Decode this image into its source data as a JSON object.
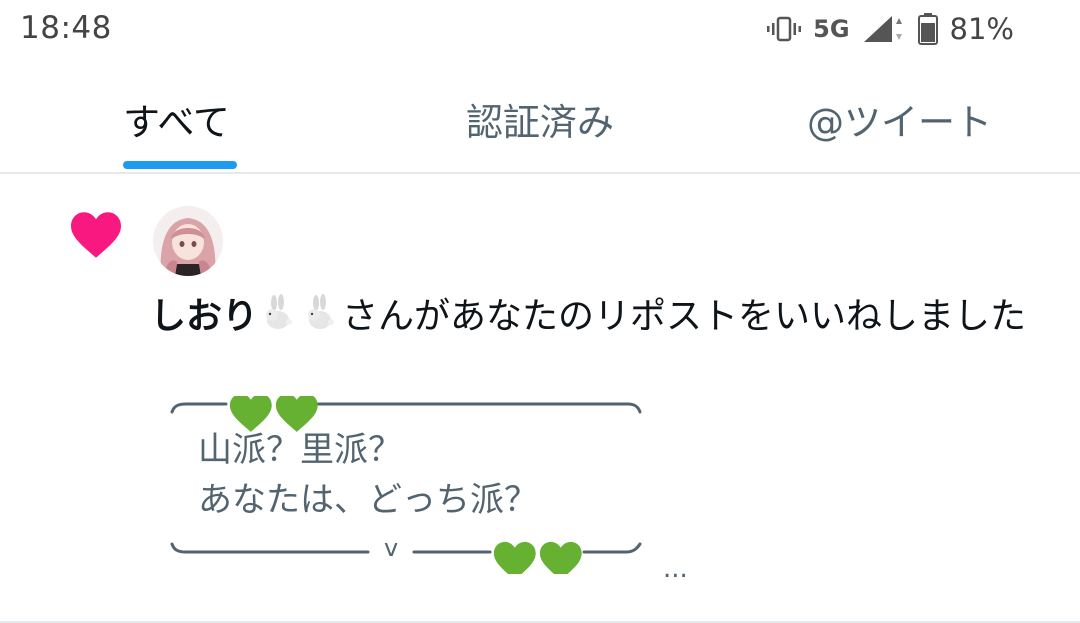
{
  "status_bar": {
    "time": "18:48",
    "network": "5G",
    "battery_percent": "81%",
    "battery_level": 0.81
  },
  "tabs": [
    {
      "label": "すべて",
      "active": true
    },
    {
      "label": "認証済み",
      "active": false
    },
    {
      "label": "@ツイート",
      "active": false
    }
  ],
  "notification": {
    "type_icon": "heart-icon",
    "user_name": "しおり",
    "name_emojis": [
      "rabbit-emoji",
      "rabbit-emoji"
    ],
    "action_text": "さんがあなたのリポストをいいねしました",
    "quote": {
      "line1": "山派？里派？",
      "line2": "あなたは、どっち派？",
      "frame_mark": "v",
      "decoration": "green-heart-emoji"
    },
    "more_indicator": "..."
  },
  "colors": {
    "accent": "#1d9bf0",
    "like": "#f91880",
    "secondary_text": "#536471",
    "green_heart": "#66b032"
  }
}
